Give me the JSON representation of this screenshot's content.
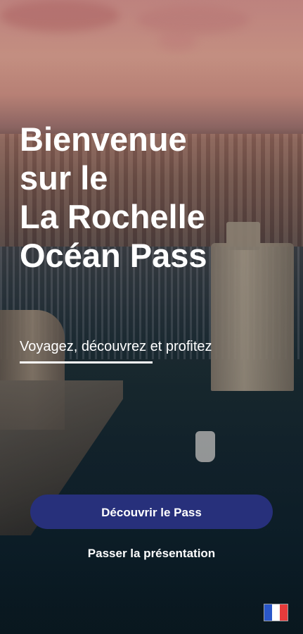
{
  "hero": {
    "title_lines": [
      "Bienvenue",
      "sur le",
      "La Rochelle",
      "Océan Pass"
    ],
    "subtitle": "Voyagez, découvrez et profitez"
  },
  "actions": {
    "primary_label": "Découvrir le Pass",
    "skip_label": "Passer la présentation"
  },
  "language": {
    "icon": "france-flag-icon",
    "colors": [
      "#2a57c9",
      "#ffffff",
      "#e63b3b"
    ]
  },
  "theme": {
    "primary_button_color": "#27307b",
    "text_color": "#ffffff"
  }
}
